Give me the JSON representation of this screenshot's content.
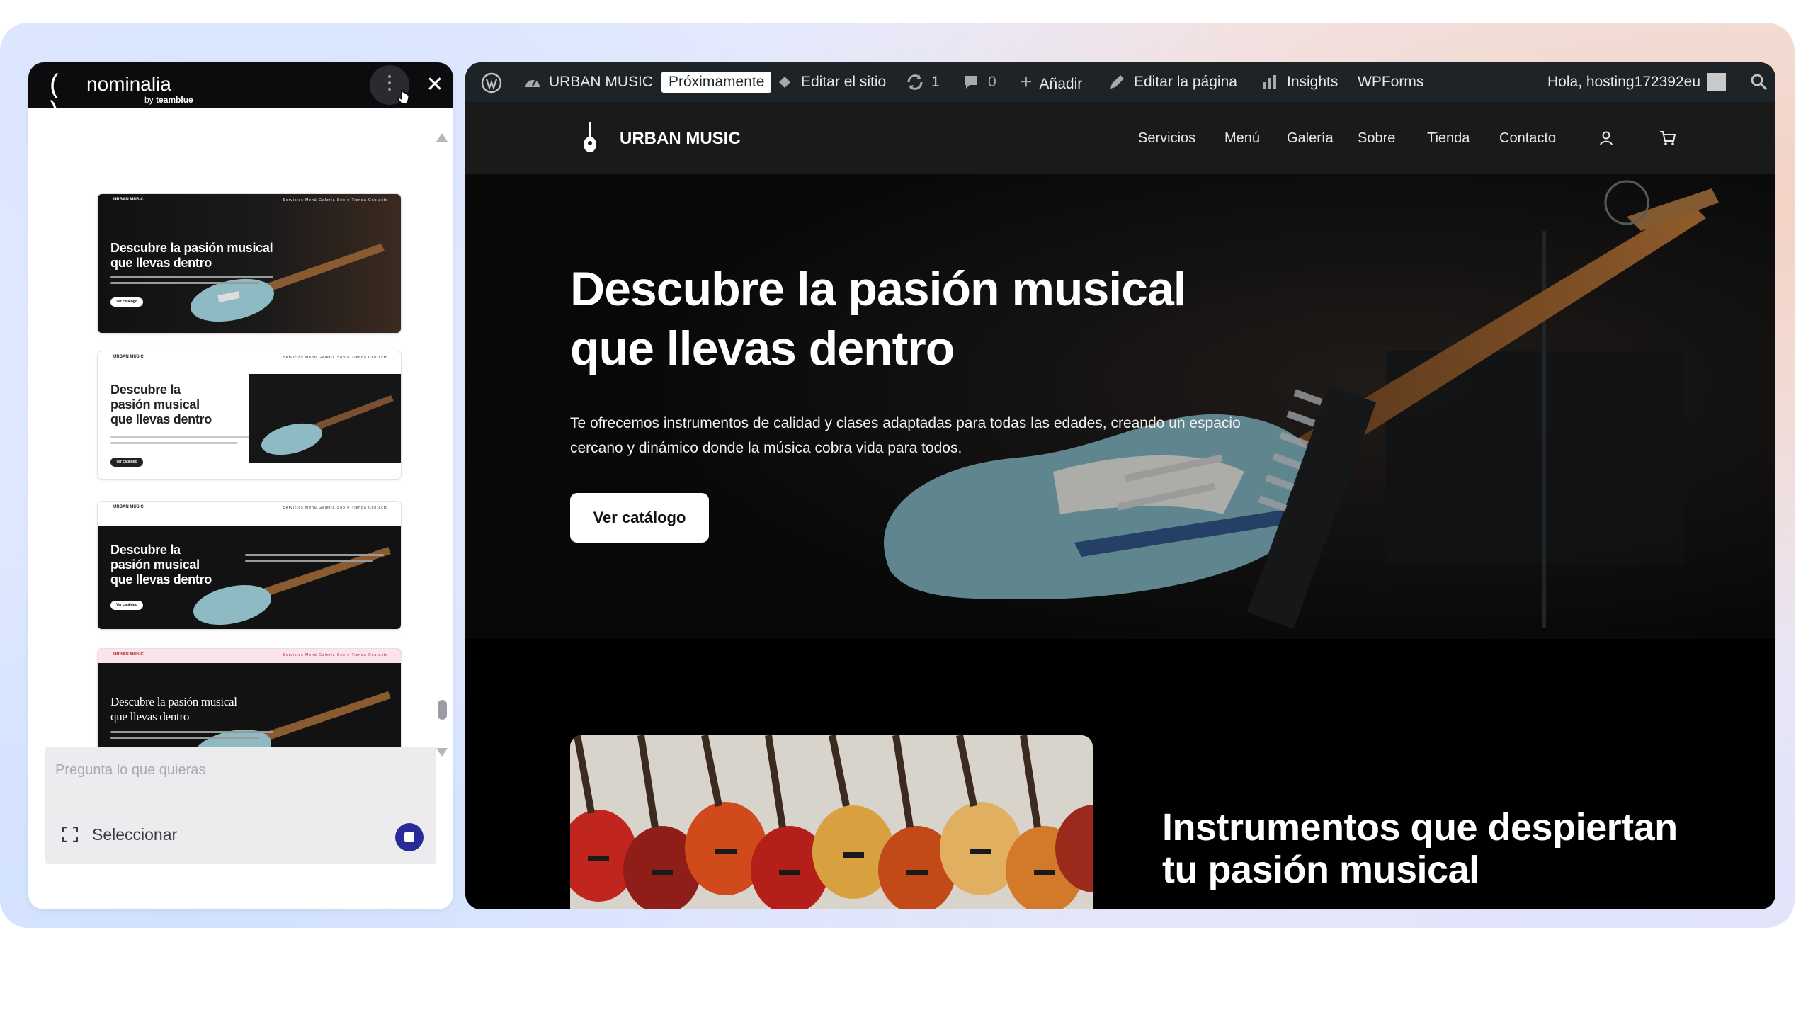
{
  "assistant": {
    "brand": "nominalia",
    "by_prefix": "by",
    "by_brand": "teamblue",
    "brackets": "( )",
    "close_glyph": "✕",
    "chat_placeholder": "Pregunta lo que quieras",
    "select_label": "Seleccionar",
    "thumbnails": [
      {
        "title": "Descubre la pasión musical que llevas dentro",
        "style": "dark-overlay"
      },
      {
        "title": "Descubre la pasión musical que llevas dentro",
        "style": "light-split"
      },
      {
        "title": "Descubre la pasión musical que llevas dentro",
        "style": "dark-two-column"
      },
      {
        "title": "Descubre la pasión musical que llevas dentro",
        "style": "pink-header-dark"
      }
    ],
    "thumb_brand": "URBAN MUSIC",
    "thumb_nav": "Servicios Menú Galería Sobre Tienda Contacto",
    "thumb_button": "Ver catálogo"
  },
  "wpbar": {
    "site_name": "URBAN MUSIC",
    "badge": "Próximamente",
    "edit_site": "Editar el sitio",
    "updates_count": "1",
    "comments_count": "0",
    "add": "Añadir",
    "edit_page": "Editar la página",
    "insights": "Insights",
    "wpforms": "WPForms",
    "greeting": "Hola, hosting172392eu"
  },
  "site": {
    "brand": "URBAN MUSIC",
    "nav": [
      "Servicios",
      "Menú",
      "Galería",
      "Sobre",
      "Tienda",
      "Contacto"
    ],
    "hero_title": "Descubre la pasión musical que llevas dentro",
    "hero_text": "Te ofrecemos instrumentos de calidad y clases adaptadas para todas las edades, creando un espacio cercano y dinámico donde la música cobra vida para todos.",
    "cta": "Ver catálogo",
    "section_title": "Instrumentos que despiertan tu pasión musical"
  },
  "colors": {
    "wp_admin_bar": "#1d2327",
    "site_header": "#1a1a1a",
    "guitar_body": "#7fb3be",
    "stop_button": "#2a2a9a"
  },
  "icons": [
    "wordpress-icon",
    "dashboard-icon",
    "edit-site-icon",
    "updates-icon",
    "comments-icon",
    "plus-icon",
    "pencil-icon",
    "insights-icon",
    "search-icon",
    "guitar-icon",
    "user-icon",
    "cart-icon",
    "menu-dots-icon",
    "close-icon",
    "select-icon",
    "stop-icon",
    "cursor-icon"
  ]
}
